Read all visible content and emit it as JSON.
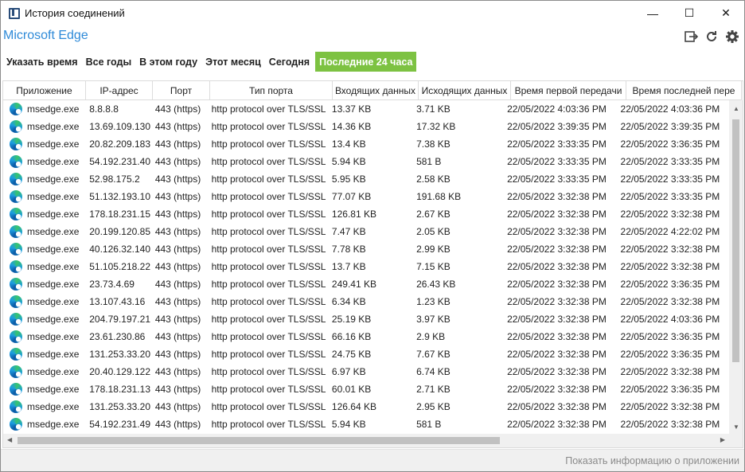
{
  "window": {
    "title": "История соединений",
    "controls": {
      "minimize": "—",
      "maximize": "☐",
      "close": "✕"
    }
  },
  "header": {
    "app_name": "Microsoft Edge",
    "icons": [
      "export-icon",
      "refresh-icon",
      "settings-icon"
    ]
  },
  "filters": [
    {
      "label": "Указать время",
      "active": false
    },
    {
      "label": "Все годы",
      "active": false
    },
    {
      "label": "В этом году",
      "active": false
    },
    {
      "label": "Этот месяц",
      "active": false
    },
    {
      "label": "Сегодня",
      "active": false
    },
    {
      "label": "Последние 24 часа",
      "active": true
    }
  ],
  "accent_color": "#7dc242",
  "table": {
    "columns": [
      "Приложение",
      "IP-адрес",
      "Порт",
      "Тип порта",
      "Входящих данных",
      "Исходящих данных",
      "Время первой передачи",
      "Время последней пере"
    ],
    "rows": [
      [
        "msedge.exe",
        "8.8.8.8",
        "443 (https)",
        "http protocol over TLS/SSL",
        "13.37 KB",
        "3.71 KB",
        "22/05/2022 4:03:36 PM",
        "22/05/2022 4:03:36 PM"
      ],
      [
        "msedge.exe",
        "13.69.109.130",
        "443 (https)",
        "http protocol over TLS/SSL",
        "14.36 KB",
        "17.32 KB",
        "22/05/2022 3:39:35 PM",
        "22/05/2022 3:39:35 PM"
      ],
      [
        "msedge.exe",
        "20.82.209.183",
        "443 (https)",
        "http protocol over TLS/SSL",
        "13.4 KB",
        "7.38 KB",
        "22/05/2022 3:33:35 PM",
        "22/05/2022 3:36:35 PM"
      ],
      [
        "msedge.exe",
        "54.192.231.40",
        "443 (https)",
        "http protocol over TLS/SSL",
        "5.94 KB",
        "581 B",
        "22/05/2022 3:33:35 PM",
        "22/05/2022 3:33:35 PM"
      ],
      [
        "msedge.exe",
        "52.98.175.2",
        "443 (https)",
        "http protocol over TLS/SSL",
        "5.95 KB",
        "2.58 KB",
        "22/05/2022 3:33:35 PM",
        "22/05/2022 3:33:35 PM"
      ],
      [
        "msedge.exe",
        "51.132.193.104",
        "443 (https)",
        "http protocol over TLS/SSL",
        "77.07 KB",
        "191.68 KB",
        "22/05/2022 3:32:38 PM",
        "22/05/2022 3:33:35 PM"
      ],
      [
        "msedge.exe",
        "178.18.231.152",
        "443 (https)",
        "http protocol over TLS/SSL",
        "126.81 KB",
        "2.67 KB",
        "22/05/2022 3:32:38 PM",
        "22/05/2022 3:32:38 PM"
      ],
      [
        "msedge.exe",
        "20.199.120.85",
        "443 (https)",
        "http protocol over TLS/SSL",
        "7.47 KB",
        "2.05 KB",
        "22/05/2022 3:32:38 PM",
        "22/05/2022 4:22:02 PM"
      ],
      [
        "msedge.exe",
        "40.126.32.140",
        "443 (https)",
        "http protocol over TLS/SSL",
        "7.78 KB",
        "2.99 KB",
        "22/05/2022 3:32:38 PM",
        "22/05/2022 3:32:38 PM"
      ],
      [
        "msedge.exe",
        "51.105.218.222",
        "443 (https)",
        "http protocol over TLS/SSL",
        "13.7 KB",
        "7.15 KB",
        "22/05/2022 3:32:38 PM",
        "22/05/2022 3:32:38 PM"
      ],
      [
        "msedge.exe",
        "23.73.4.69",
        "443 (https)",
        "http protocol over TLS/SSL",
        "249.41 KB",
        "26.43 KB",
        "22/05/2022 3:32:38 PM",
        "22/05/2022 3:36:35 PM"
      ],
      [
        "msedge.exe",
        "13.107.43.16",
        "443 (https)",
        "http protocol over TLS/SSL",
        "6.34 KB",
        "1.23 KB",
        "22/05/2022 3:32:38 PM",
        "22/05/2022 3:32:38 PM"
      ],
      [
        "msedge.exe",
        "204.79.197.219",
        "443 (https)",
        "http protocol over TLS/SSL",
        "25.19 KB",
        "3.97 KB",
        "22/05/2022 3:32:38 PM",
        "22/05/2022 4:03:36 PM"
      ],
      [
        "msedge.exe",
        "23.61.230.86",
        "443 (https)",
        "http protocol over TLS/SSL",
        "66.16 KB",
        "2.9 KB",
        "22/05/2022 3:32:38 PM",
        "22/05/2022 3:36:35 PM"
      ],
      [
        "msedge.exe",
        "131.253.33.203",
        "443 (https)",
        "http protocol over TLS/SSL",
        "24.75 KB",
        "7.67 KB",
        "22/05/2022 3:32:38 PM",
        "22/05/2022 3:36:35 PM"
      ],
      [
        "msedge.exe",
        "20.40.129.122",
        "443 (https)",
        "http protocol over TLS/SSL",
        "6.97 KB",
        "6.74 KB",
        "22/05/2022 3:32:38 PM",
        "22/05/2022 3:32:38 PM"
      ],
      [
        "msedge.exe",
        "178.18.231.137",
        "443 (https)",
        "http protocol over TLS/SSL",
        "60.01 KB",
        "2.71 KB",
        "22/05/2022 3:32:38 PM",
        "22/05/2022 3:36:35 PM"
      ],
      [
        "msedge.exe",
        "131.253.33.200",
        "443 (https)",
        "http protocol over TLS/SSL",
        "126.64 KB",
        "2.95 KB",
        "22/05/2022 3:32:38 PM",
        "22/05/2022 3:32:38 PM"
      ],
      [
        "msedge.exe",
        "54.192.231.49",
        "443 (https)",
        "http protocol over TLS/SSL",
        "5.94 KB",
        "581 B",
        "22/05/2022 3:32:38 PM",
        "22/05/2022 3:32:38 PM"
      ]
    ]
  },
  "footer": {
    "link": "Показать информацию о приложении"
  }
}
